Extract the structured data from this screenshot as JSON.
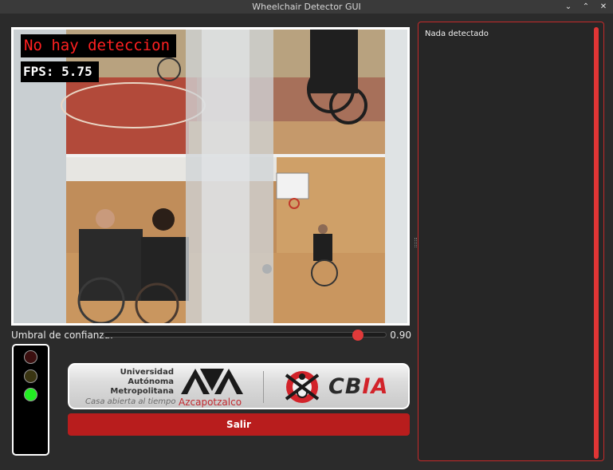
{
  "window": {
    "title": "Wheelchair Detector GUI",
    "controls": {
      "minimize": "⌄",
      "maximize": "⌃",
      "close": "✕"
    }
  },
  "camera": {
    "status_text": "No hay deteccion",
    "fps_text": "FPS: 5.75"
  },
  "threshold": {
    "label": "Umbral de confianza:",
    "value": 0.9,
    "value_text": "0.90"
  },
  "traffic_light": {
    "lights": [
      {
        "name": "red",
        "active": false,
        "color": "#3b0f0f"
      },
      {
        "name": "yellow",
        "active": false,
        "color": "#3a3512"
      },
      {
        "name": "green",
        "active": true,
        "color": "#22ee22"
      }
    ]
  },
  "logos": {
    "uam_lines": [
      "Universidad",
      "Autónoma",
      "Metropolitana"
    ],
    "uam_motto": "Casa abierta al tiempo",
    "uam_campus": "Azcapotzalco",
    "cbia_prefix": "CB",
    "cbia_suffix": "IA"
  },
  "exit_button": {
    "label": "Salir"
  },
  "detections_panel": {
    "text": "Nada detectado"
  },
  "colors": {
    "accent": "#e03a3a",
    "button": "#b81d1d",
    "panel_border": "#c42a2a"
  }
}
